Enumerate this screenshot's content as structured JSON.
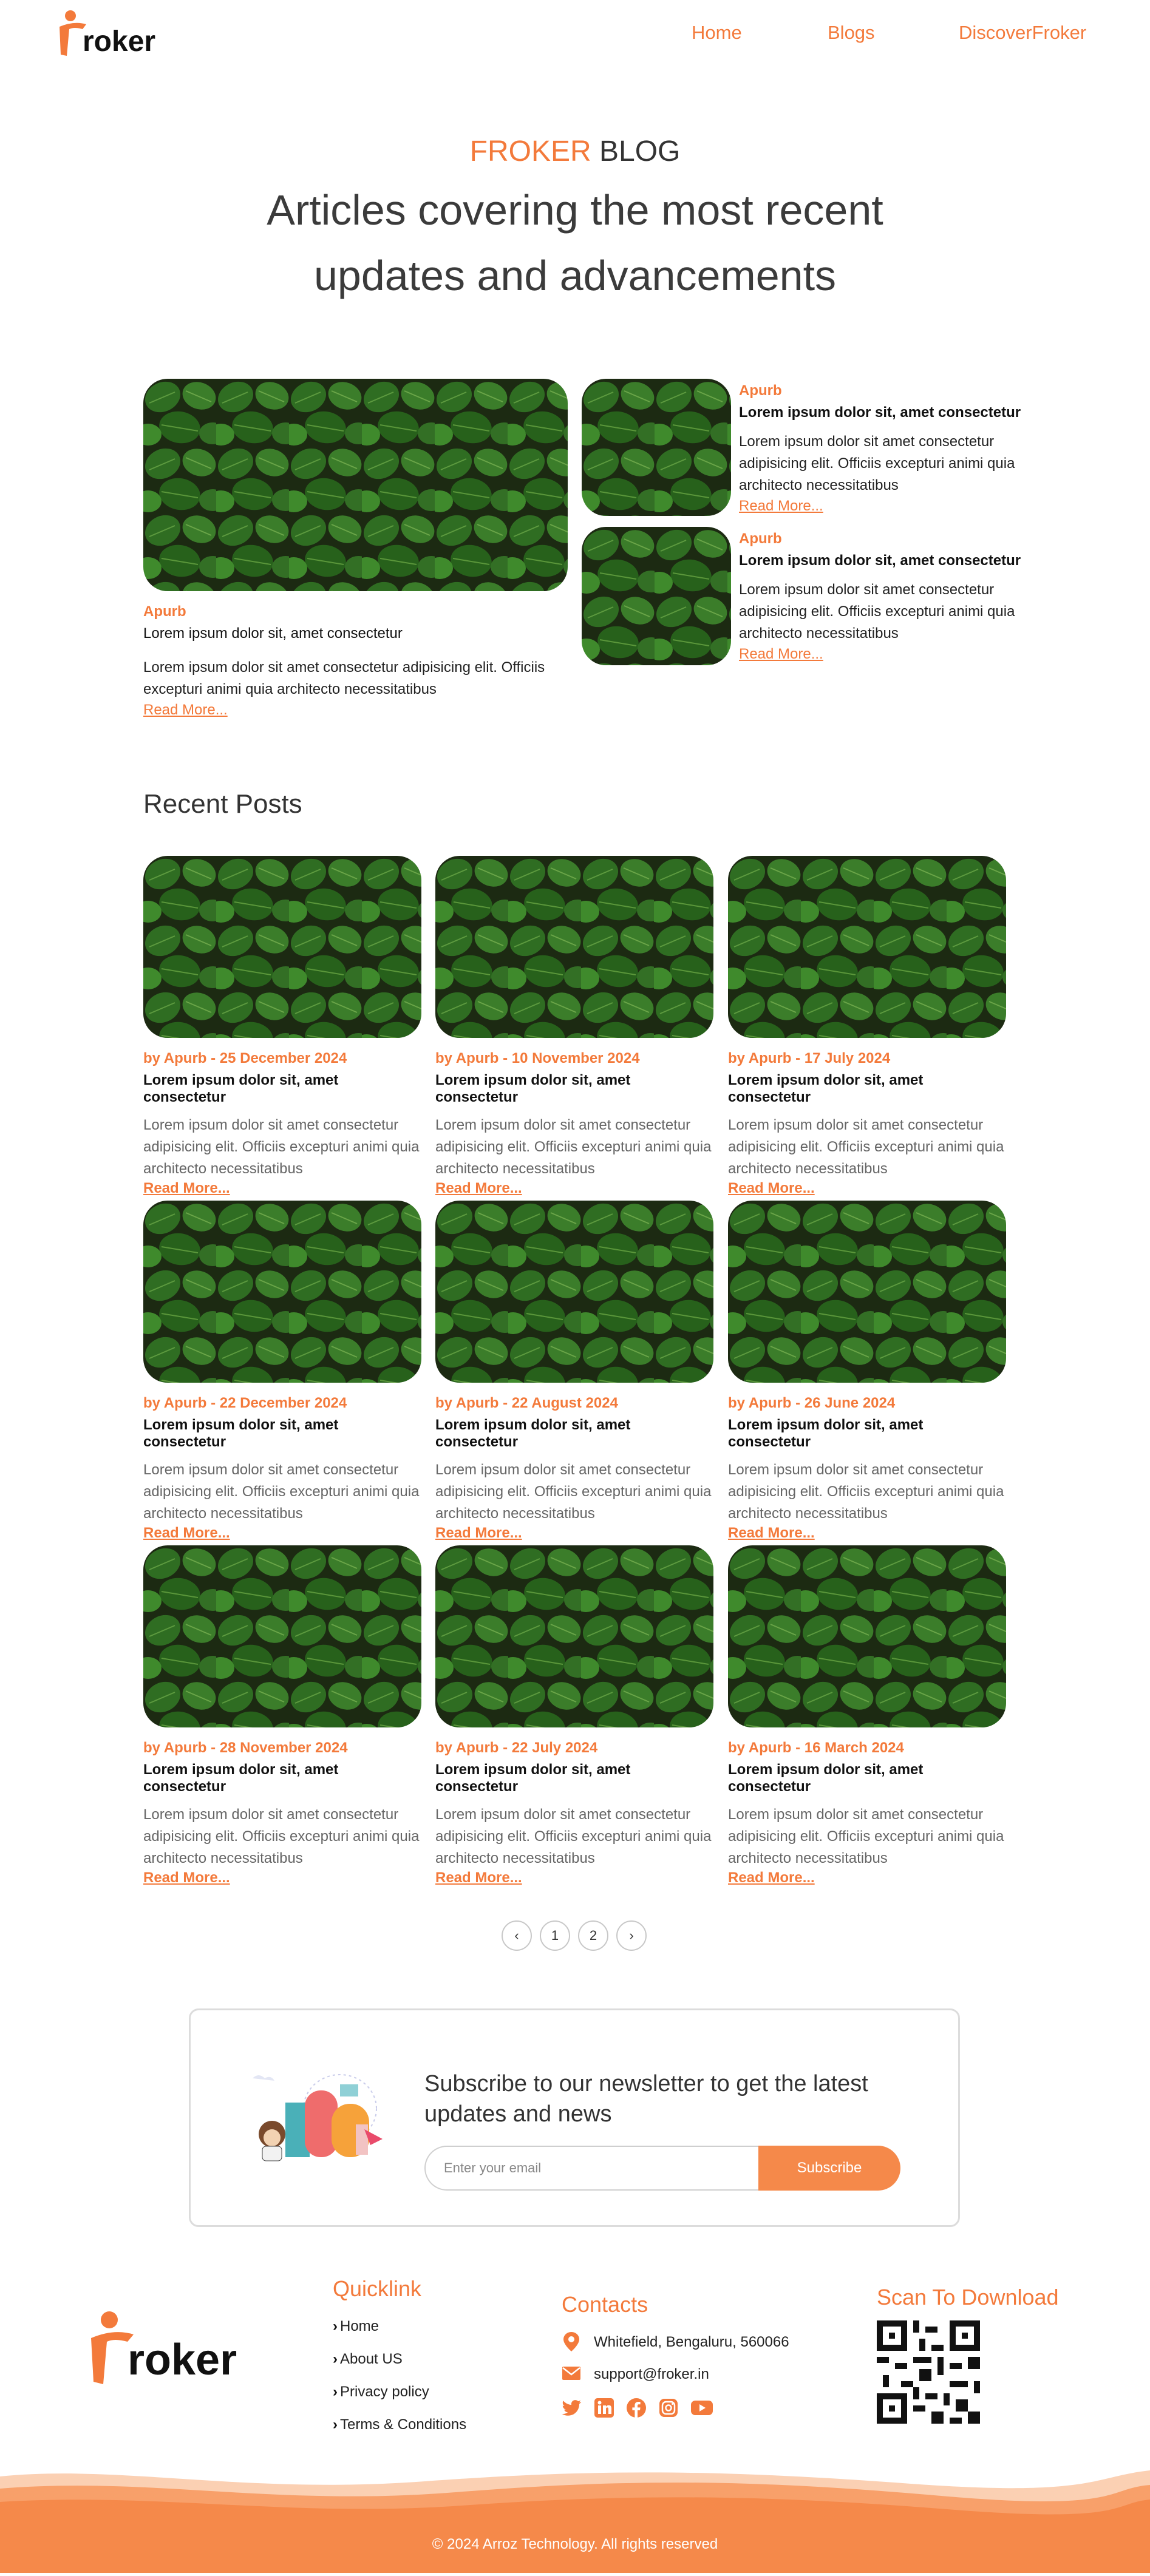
{
  "header": {
    "logo_text": "roker",
    "nav": [
      "Home",
      "Blogs",
      "DiscoverFroker"
    ]
  },
  "hero": {
    "eyebrow_accent": "FROKER",
    "eyebrow_rest": " BLOG",
    "headline": "Articles covering the most recent updates and advancements"
  },
  "featured": {
    "main": {
      "author": "Apurb",
      "title": "Lorem ipsum dolor sit, amet consectetur",
      "desc": "Lorem ipsum dolor sit amet consectetur adipisicing elit. Officiis excepturi animi quia architecto necessitatibus",
      "more": "Read More..."
    },
    "side": [
      {
        "author": "Apurb",
        "title": "Lorem ipsum dolor sit, amet consectetur",
        "desc": "Lorem ipsum dolor sit amet consectetur adipisicing elit. Officiis excepturi animi quia architecto necessitatibus",
        "more": "Read More..."
      },
      {
        "author": "Apurb",
        "title": "Lorem ipsum dolor sit, amet consectetur",
        "desc": "Lorem ipsum dolor sit amet consectetur adipisicing elit. Officiis excepturi animi quia architecto necessitatibus",
        "more": "Read More..."
      }
    ]
  },
  "recent": {
    "title": "Recent Posts",
    "posts": [
      {
        "meta": "by Apurb - 25 December 2024",
        "title": "Lorem ipsum dolor sit, amet consectetur",
        "desc": "Lorem ipsum dolor sit amet consectetur adipisicing elit. Officiis excepturi animi quia architecto necessitatibus",
        "more": "Read More..."
      },
      {
        "meta": "by Apurb - 10 November 2024",
        "title": "Lorem ipsum dolor sit, amet consectetur",
        "desc": "Lorem ipsum dolor sit amet consectetur adipisicing elit. Officiis excepturi animi quia architecto necessitatibus",
        "more": "Read More..."
      },
      {
        "meta": "by Apurb - 17 July 2024",
        "title": "Lorem ipsum dolor sit, amet consectetur",
        "desc": "Lorem ipsum dolor sit amet consectetur adipisicing elit. Officiis excepturi animi quia architecto necessitatibus",
        "more": "Read More..."
      },
      {
        "meta": "by Apurb - 22 December 2024",
        "title": "Lorem ipsum dolor sit, amet consectetur",
        "desc": "Lorem ipsum dolor sit amet consectetur adipisicing elit. Officiis excepturi animi quia architecto necessitatibus",
        "more": "Read More..."
      },
      {
        "meta": "by Apurb - 22 August 2024",
        "title": "Lorem ipsum dolor sit, amet consectetur",
        "desc": "Lorem ipsum dolor sit amet consectetur adipisicing elit. Officiis excepturi animi quia architecto necessitatibus",
        "more": "Read More..."
      },
      {
        "meta": "by Apurb - 26 June 2024",
        "title": "Lorem ipsum dolor sit, amet consectetur",
        "desc": "Lorem ipsum dolor sit amet consectetur adipisicing elit. Officiis excepturi animi quia architecto necessitatibus",
        "more": "Read More..."
      },
      {
        "meta": "by Apurb - 28 November 2024",
        "title": "Lorem ipsum dolor sit, amet consectetur",
        "desc": "Lorem ipsum dolor sit amet consectetur adipisicing elit. Officiis excepturi animi quia architecto necessitatibus",
        "more": "Read More..."
      },
      {
        "meta": "by Apurb - 22 July 2024",
        "title": "Lorem ipsum dolor sit, amet consectetur",
        "desc": "Lorem ipsum dolor sit amet consectetur adipisicing elit. Officiis excepturi animi quia architecto necessitatibus",
        "more": "Read More..."
      },
      {
        "meta": "by Apurb - 16 March 2024",
        "title": "Lorem ipsum dolor sit, amet consectetur",
        "desc": "Lorem ipsum dolor sit amet consectetur adipisicing elit. Officiis excepturi animi quia architecto necessitatibus",
        "more": "Read More..."
      }
    ]
  },
  "pagination": {
    "prev": "‹",
    "pages": [
      "1",
      "2"
    ],
    "next": "›"
  },
  "newsletter": {
    "title": "Subscribe to our newsletter to get the latest updates and news",
    "placeholder": "Enter your email",
    "button": "Subscribe"
  },
  "footer": {
    "logo_text": "roker",
    "quicklink_title": "Quicklink",
    "links": [
      "Home",
      "About US",
      "Privacy policy",
      "Terms & Conditions"
    ],
    "contacts_title": "Contacts",
    "address": "Whitefield, Bengaluru, 560066",
    "email": "support@froker.in",
    "social_icons": [
      "twitter-icon",
      "linkedin-icon",
      "facebook-icon",
      "instagram-icon",
      "youtube-icon"
    ],
    "scan_title": "Scan To Download",
    "copyright": "© 2024 Arroz Technology. All rights reserved"
  },
  "colors": {
    "accent": "#f37a3b",
    "button": "#f5894a",
    "wave": "#f5894a",
    "leaf": "#2f6b1f"
  }
}
